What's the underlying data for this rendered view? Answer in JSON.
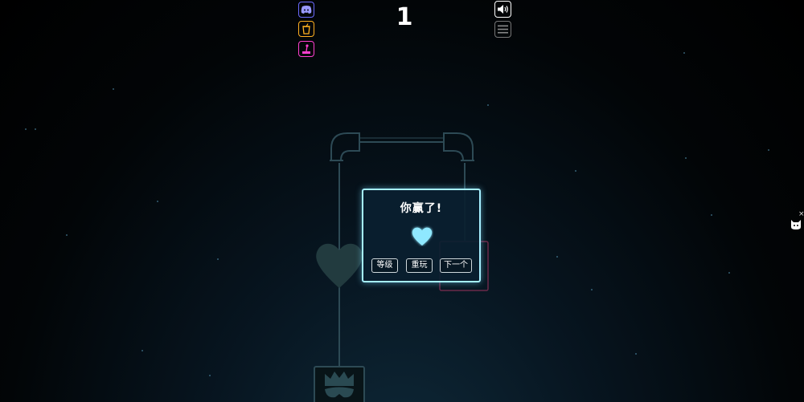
{
  "hud": {
    "level_number": "1",
    "discord_icon": "discord-icon",
    "drink_icon": "drink-cup-icon",
    "joystick_icon": "joystick-icon",
    "sound_icon": "speaker-on-icon",
    "menu_icon": "hamburger-menu-icon"
  },
  "win_dialog": {
    "title": "你赢了!",
    "heart_icon": "heart-icon",
    "buttons": {
      "levels": "等级",
      "replay": "重玩",
      "next": "下一个"
    }
  },
  "side_widget": {
    "close_label": "×",
    "icon": "cat-icon"
  },
  "colors": {
    "dialog_border": "#a6efff",
    "heart_glow": "#8fe8ff",
    "discord": "#6b6bff",
    "drink": "#ffb020",
    "joystick": "#ff3fd0"
  }
}
